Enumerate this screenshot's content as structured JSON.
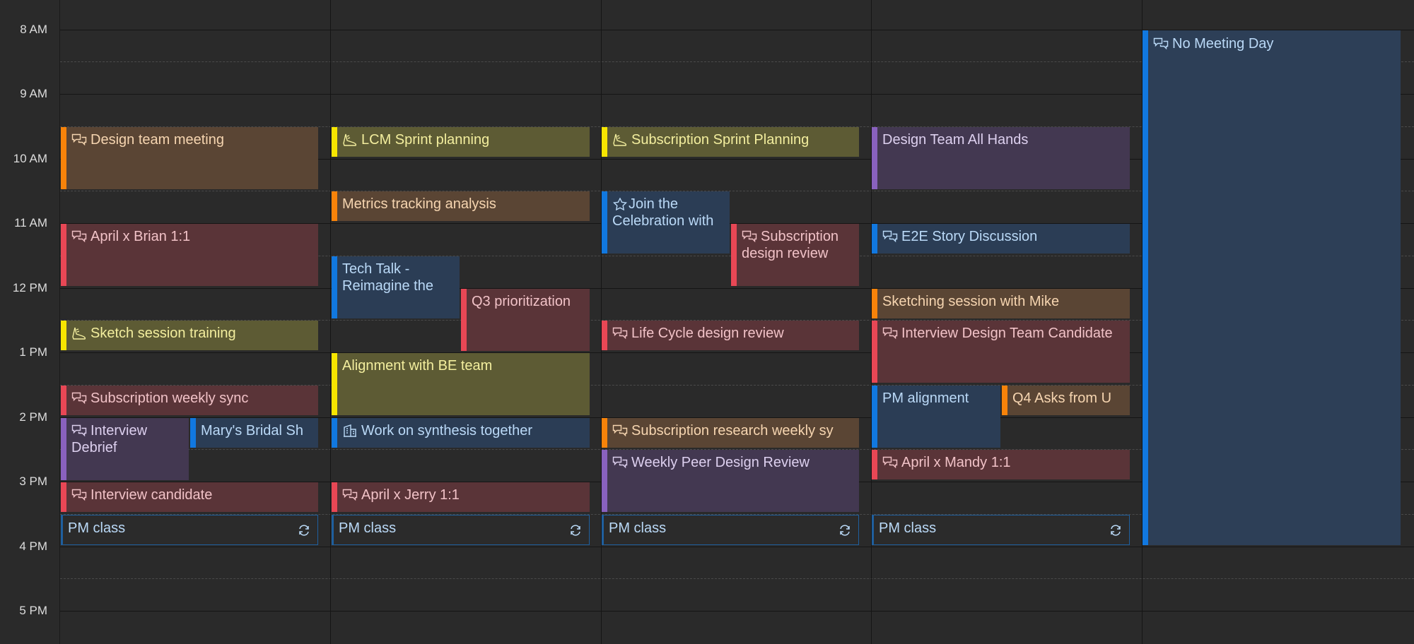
{
  "times": [
    "8 AM",
    "9 AM",
    "10 AM",
    "11 AM",
    "12 PM",
    "1 PM",
    "2 PM",
    "3 PM",
    "4 PM",
    "5 PM"
  ],
  "icons": {
    "chat": "chat-bubbles-icon",
    "sprint": "running-shoe-icon",
    "star": "star-icon",
    "building": "building-icon",
    "recurring": "recurring-icon"
  },
  "colors": {
    "orange": "#f7830a",
    "yellow": "#f7e600",
    "red": "#e84755",
    "blue": "#1178e0",
    "purple": "#8961be"
  },
  "days": [
    {
      "events": [
        {
          "title": "Design team meeting",
          "icon": "chat"
        },
        {
          "title": "April x Brian 1:1",
          "icon": "chat"
        },
        {
          "title": "Sketch session training",
          "icon": "sprint"
        },
        {
          "title": "Subscription weekly sync",
          "icon": "chat"
        },
        {
          "title": "Interview Debrief",
          "icon": "chat"
        },
        {
          "title": "Mary's Bridal Sh"
        },
        {
          "title": "Interview candidate",
          "icon": "chat"
        },
        {
          "title": "PM class",
          "recurring": true
        }
      ]
    },
    {
      "events": [
        {
          "title": "LCM Sprint planning",
          "icon": "sprint"
        },
        {
          "title": "Metrics tracking analysis"
        },
        {
          "title": "Tech Talk - Reimagine the"
        },
        {
          "title": "Q3 prioritization"
        },
        {
          "title": "Alignment with BE team"
        },
        {
          "title": "Work on synthesis together",
          "icon": "building"
        },
        {
          "title": "April x Jerry 1:1",
          "icon": "chat"
        },
        {
          "title": "PM class",
          "recurring": true
        }
      ]
    },
    {
      "events": [
        {
          "title": "Subscription Sprint Planning",
          "icon": "sprint"
        },
        {
          "title": "Join the Celebration with",
          "icon": "star"
        },
        {
          "title": "Subscription design review",
          "icon": "chat"
        },
        {
          "title": "Life Cycle design review",
          "icon": "chat"
        },
        {
          "title": "Subscription research weekly sy",
          "icon": "chat"
        },
        {
          "title": "Weekly Peer Design Review",
          "icon": "chat"
        },
        {
          "title": "PM class",
          "recurring": true
        }
      ]
    },
    {
      "events": [
        {
          "title": "Design Team All Hands"
        },
        {
          "title": "E2E Story Discussion",
          "icon": "chat"
        },
        {
          "title": "Sketching session with Mike"
        },
        {
          "title": "Interview Design Team Candidate",
          "icon": "chat"
        },
        {
          "title": "PM alignment"
        },
        {
          "title": "Q4 Asks from U"
        },
        {
          "title": "April x Mandy 1:1",
          "icon": "chat"
        },
        {
          "title": "PM class",
          "recurring": true
        }
      ]
    },
    {
      "events": [
        {
          "title": "No Meeting Day",
          "icon": "chat"
        }
      ]
    }
  ]
}
